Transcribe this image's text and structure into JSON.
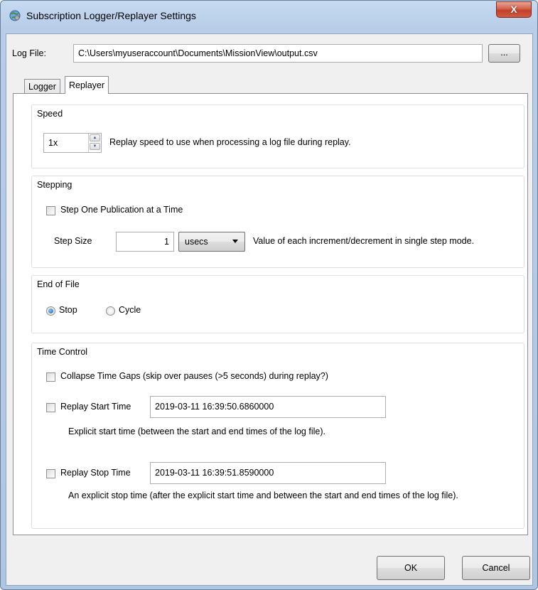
{
  "window": {
    "title": "Subscription Logger/Replayer Settings",
    "close_symbol": "X"
  },
  "log_file": {
    "label": "Log File:",
    "path": "C:\\Users\\myuseraccount\\Documents\\MissionView\\output.csv",
    "browse_label": "..."
  },
  "tabs": [
    {
      "label": "Logger",
      "active": false
    },
    {
      "label": "Replayer",
      "active": true
    }
  ],
  "speed": {
    "title": "Speed",
    "value": "1x",
    "description": "Replay speed to use when processing a log file during replay."
  },
  "stepping": {
    "title": "Stepping",
    "step_one_label": "Step One Publication at a Time",
    "step_one_checked": false,
    "step_size_label": "Step Size",
    "step_size_value": "1",
    "unit": "usecs",
    "description": "Value of each increment/decrement in single step mode."
  },
  "end_of_file": {
    "title": "End of File",
    "options": [
      {
        "label": "Stop",
        "checked": true
      },
      {
        "label": "Cycle",
        "checked": false
      }
    ]
  },
  "time_control": {
    "title": "Time Control",
    "collapse_label": "Collapse Time Gaps (skip over pauses (>5 seconds) during replay?)",
    "start_label": "Replay Start Time",
    "start_value": "2019-03-11 16:39:50.6860000",
    "start_description": "Explicit start time (between the start and end times of the log file).",
    "stop_label": "Replay Stop Time",
    "stop_value": "2019-03-11 16:39:51.8590000",
    "stop_description": "An explicit stop time (after the explicit start time and between the start and end times of the log file)."
  },
  "footer": {
    "ok_label": "OK",
    "cancel_label": "Cancel"
  }
}
